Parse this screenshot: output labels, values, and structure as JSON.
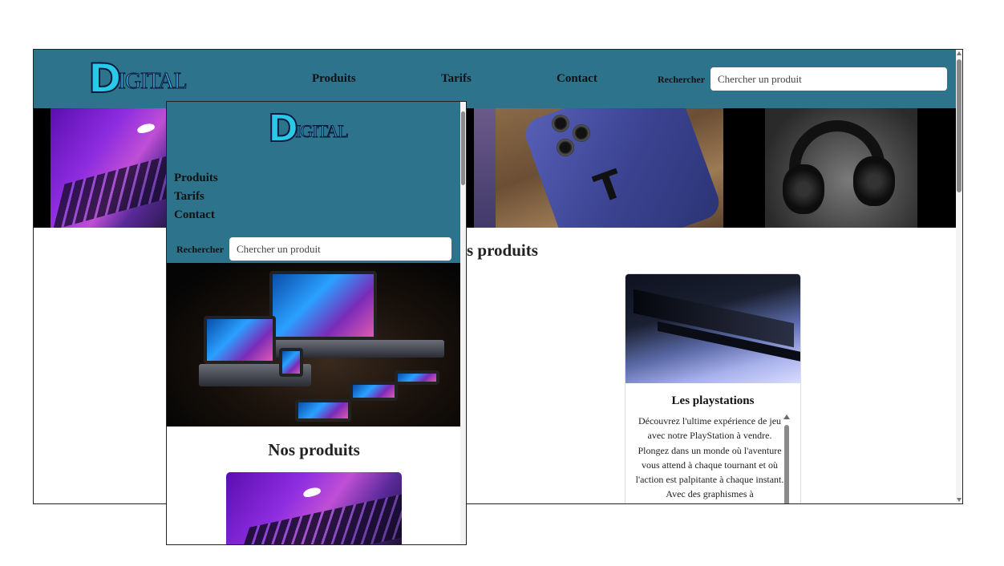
{
  "desktop": {
    "logo": {
      "initial": "D",
      "rest": "IGITAL"
    },
    "nav": {
      "links": [
        "Produits",
        "Tarifs",
        "Contact"
      ]
    },
    "search": {
      "label": "Rechercher",
      "placeholder": "Chercher un produit"
    },
    "section_title": "Nos produits",
    "visible_section_title_fragment": "s produits",
    "card": {
      "title": "Les playstations",
      "text": "Découvrez l'ultime expérience de jeu avec notre PlayStation à vendre. Plongez dans un monde où l'aventure vous attend à chaque tournant et où l'action est palpitante à chaque instant. Avec des graphismes à"
    }
  },
  "mobile": {
    "logo": {
      "initial": "D",
      "rest": "IGITAL"
    },
    "nav": {
      "links": [
        "Produits",
        "Tarifs",
        "Contact"
      ]
    },
    "search": {
      "label": "Rechercher",
      "placeholder": "Chercher un produit"
    },
    "section_title": "Nos produits"
  },
  "colors": {
    "nav_bg": "#2e738c",
    "logo_cyan": "#29c9ea",
    "text": "#111111"
  }
}
